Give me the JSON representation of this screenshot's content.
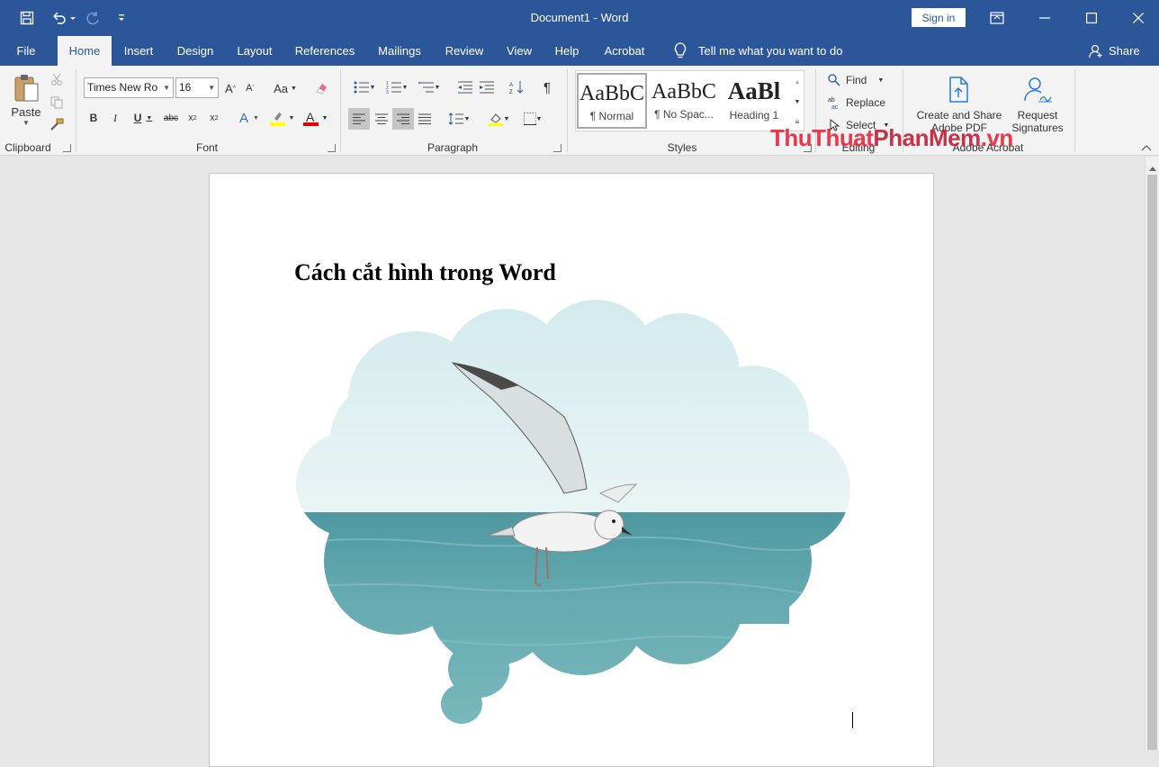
{
  "window": {
    "title": "Document1  -  Word",
    "sign_in_label": "Sign in"
  },
  "tabs": [
    {
      "label": "File"
    },
    {
      "label": "Home"
    },
    {
      "label": "Insert"
    },
    {
      "label": "Design"
    },
    {
      "label": "Layout"
    },
    {
      "label": "References"
    },
    {
      "label": "Mailings"
    },
    {
      "label": "Review"
    },
    {
      "label": "View"
    },
    {
      "label": "Help"
    },
    {
      "label": "Acrobat"
    }
  ],
  "active_tab": "Home",
  "tell_me": "Tell me what you want to do",
  "share_label": "Share",
  "ribbon": {
    "clipboard": {
      "label": "Clipboard",
      "paste_label": "Paste"
    },
    "font": {
      "label": "Font",
      "font_name": "Times New Ro",
      "font_size": "16"
    },
    "paragraph": {
      "label": "Paragraph"
    },
    "styles": {
      "label": "Styles",
      "items": [
        {
          "sample": "AaBbC",
          "name": "¶ Normal"
        },
        {
          "sample": "AaBbC",
          "name": "¶ No Spac..."
        },
        {
          "sample": "AaBl",
          "name": "Heading 1"
        }
      ]
    },
    "editing": {
      "label": "Editing",
      "find_label": "Find",
      "replace_label": "Replace",
      "select_label": "Select"
    },
    "adobe": {
      "label": "Adobe Acrobat",
      "create_line1": "Create and Share",
      "create_line2": "Adobe PDF",
      "request_line1": "Request",
      "request_line2": "Signatures"
    }
  },
  "document": {
    "heading": "Cách cắt hình trong Word",
    "picture_description": "seagull over sea cropped to cloud shape"
  },
  "watermark": {
    "part1": "ThuThuat",
    "part2": "PhanMem",
    "part3": ".vn"
  },
  "colors": {
    "accent": "#2b579a",
    "highlight": "#ffff00",
    "font_color": "#e00000"
  }
}
